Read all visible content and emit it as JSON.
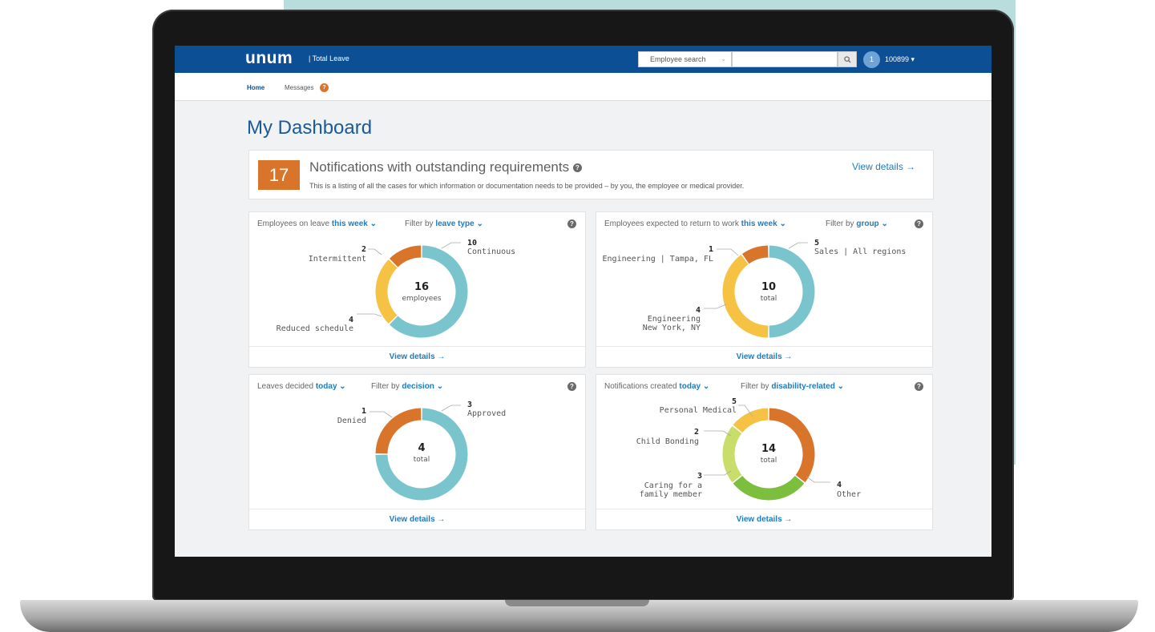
{
  "header": {
    "logo": "unum",
    "product": "| Total Leave",
    "search_type": "Employee search",
    "search_placeholder": "",
    "user_initial": "1",
    "user_id": "100899 ▾"
  },
  "nav": {
    "home": "Home",
    "messages": "Messages",
    "messages_badge": "?"
  },
  "page": {
    "title": "My Dashboard"
  },
  "notifications": {
    "count": "17",
    "title": "Notifications with outstanding requirements",
    "description": "This is a listing of all the cases for which information or documentation needs to be provided – by you, the employee or medical provider.",
    "link": "View details →"
  },
  "colors": {
    "teal": "#7ac5cd",
    "orange": "#d9752b",
    "yellow": "#f6c244",
    "green": "#7cbf3e",
    "light_green": "#c8dd6a"
  },
  "widgets": [
    {
      "title_prefix": "Employees on leave ",
      "title_highlight": "this week ⌄",
      "filter_prefix": "Filter by ",
      "filter_highlight": "leave type ⌄",
      "footer": "View details →",
      "center_value": "16",
      "center_label": "employees",
      "segments": [
        {
          "label": "Continuous",
          "value": 10,
          "color": "#7ac5cd"
        },
        {
          "label": "Reduced schedule",
          "value": 4,
          "color": "#f6c244"
        },
        {
          "label": "Intermittent",
          "value": 2,
          "color": "#d9752b"
        }
      ]
    },
    {
      "title_prefix": "Employees expected to return to work ",
      "title_highlight": "this week ⌄",
      "filter_prefix": "Filter by ",
      "filter_highlight": "group ⌄",
      "footer": "View details →",
      "center_value": "10",
      "center_label": "total",
      "segments": [
        {
          "label": "Sales | All regions",
          "value": 5,
          "color": "#7ac5cd"
        },
        {
          "label_line1": "Engineering",
          "label_line2": "New York, NY",
          "value": 4,
          "color": "#f6c244"
        },
        {
          "label": "Engineering | Tampa, FL",
          "value": 1,
          "color": "#d9752b"
        }
      ]
    },
    {
      "title_prefix": "Leaves decided ",
      "title_highlight": "today ⌄",
      "filter_prefix": "Filter by ",
      "filter_highlight": "decision ⌄",
      "footer": "View details →",
      "center_value": "4",
      "center_label": "total",
      "segments": [
        {
          "label": "Approved",
          "value": 3,
          "color": "#7ac5cd"
        },
        {
          "label": "Denied",
          "value": 1,
          "color": "#d9752b"
        }
      ]
    },
    {
      "title_prefix": "Notifications created ",
      "title_highlight": "today ⌄",
      "filter_prefix": "Filter by ",
      "filter_highlight": "disability-related ⌄",
      "footer": "View details →",
      "center_value": "14",
      "center_label": "total",
      "segments": [
        {
          "label": "Personal Medical",
          "value": 5,
          "color": "#d9752b"
        },
        {
          "label": "Other",
          "value": 4,
          "color": "#7cbf3e"
        },
        {
          "label_line1": "Caring for a",
          "label_line2": "family member",
          "value": 3,
          "color": "#c8dd6a"
        },
        {
          "label": "Child Bonding",
          "value": 2,
          "color": "#f6c244"
        }
      ]
    }
  ]
}
